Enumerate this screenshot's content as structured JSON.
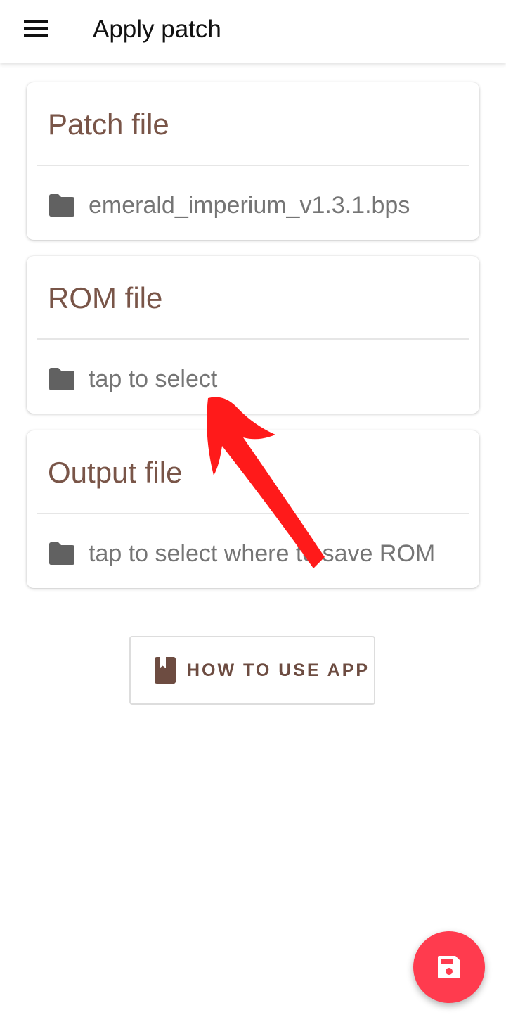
{
  "appbar": {
    "title": "Apply patch",
    "menu_icon": "hamburger-menu-icon"
  },
  "cards": [
    {
      "title": "Patch file",
      "value": "emerald_imperium_v1.3.1.bps",
      "icon": "folder-icon"
    },
    {
      "title": "ROM file",
      "value": "tap to select",
      "icon": "folder-icon"
    },
    {
      "title": "Output file",
      "value": "tap to select where to save ROM",
      "icon": "folder-icon"
    }
  ],
  "howto": {
    "label": "HOW TO USE APP",
    "icon": "book-icon"
  },
  "fab": {
    "icon": "save-icon"
  },
  "colors": {
    "accent": "#795548",
    "fab": "#ff3b4e",
    "annotation_arrow": "#ff1a1a",
    "text_secondary": "#757575",
    "icon_gray": "#616161"
  }
}
